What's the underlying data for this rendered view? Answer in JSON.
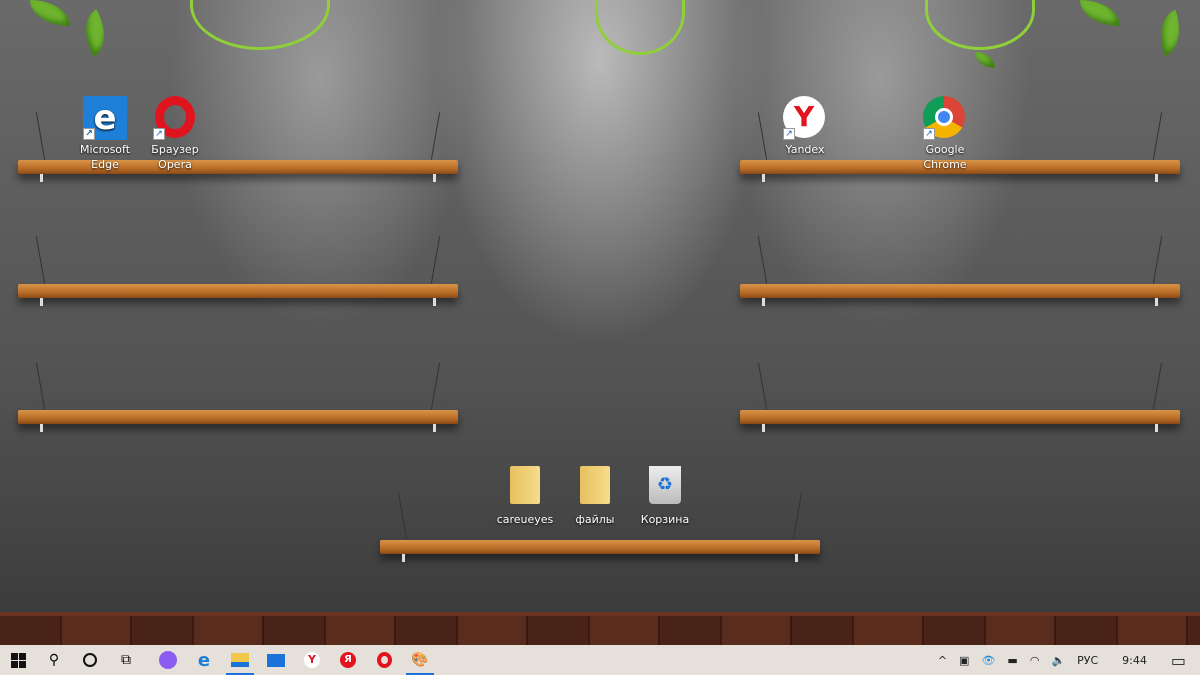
{
  "desktop_icons": [
    {
      "label": "Microsoft Edge",
      "icon": "edge-icon",
      "shortcut": true
    },
    {
      "label": "Браузер Opera",
      "icon": "opera-icon",
      "shortcut": true
    },
    {
      "label": "Yandex",
      "icon": "yandex-icon",
      "shortcut": true
    },
    {
      "label": "Google Chrome",
      "icon": "chrome-icon",
      "shortcut": true
    },
    {
      "label": "careueyes",
      "icon": "folder-icon"
    },
    {
      "label": "файлы",
      "icon": "folder-icon"
    },
    {
      "label": "Корзина",
      "icon": "recycle-bin-icon"
    }
  ],
  "taskbar": {
    "apps": [
      "start",
      "search",
      "cortana",
      "task-view",
      "alice",
      "edge",
      "file-explorer",
      "mail",
      "yandex-browser",
      "yandex",
      "opera",
      "paint"
    ],
    "active": [
      "file-explorer",
      "paint"
    ],
    "tray": {
      "language": "РУС",
      "time": "9:44"
    }
  },
  "colors": {
    "taskbar": "#e6e0da",
    "accent": "#1a73d9"
  }
}
